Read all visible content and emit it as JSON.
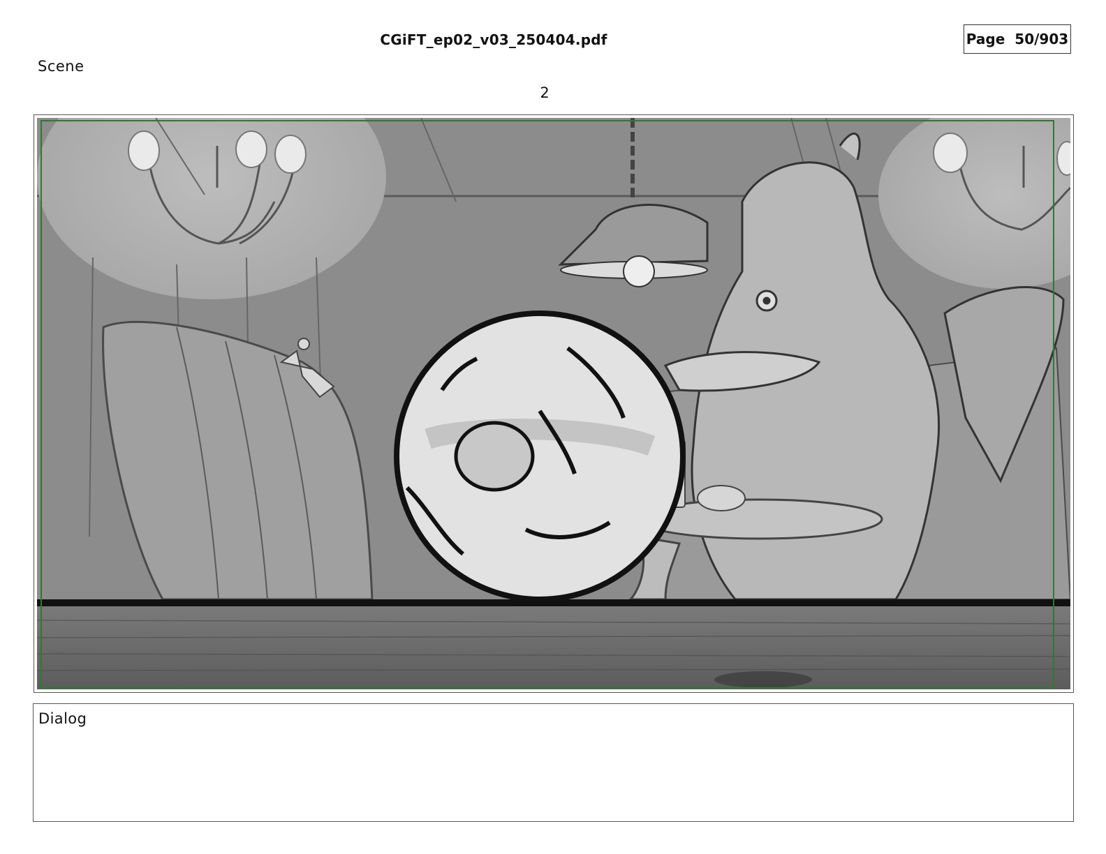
{
  "header": {
    "file_name": "CGiFT_ep02_v03_250404.pdf",
    "page_label": "Page",
    "page_number": "50/903"
  },
  "scene": {
    "label": "Scene",
    "number": "2"
  },
  "panel": {
    "image": "storyboard-sketch: restaurant booth with hanging lamp, chandeliers, creature at table, large disc in foreground, wood counter"
  },
  "dialog": {
    "label": "Dialog",
    "text": ""
  },
  "colors": {
    "safe_frame": "#2e7a2e",
    "sketch_bg": "#8a8a8a",
    "wood": "#6f6f6f"
  }
}
